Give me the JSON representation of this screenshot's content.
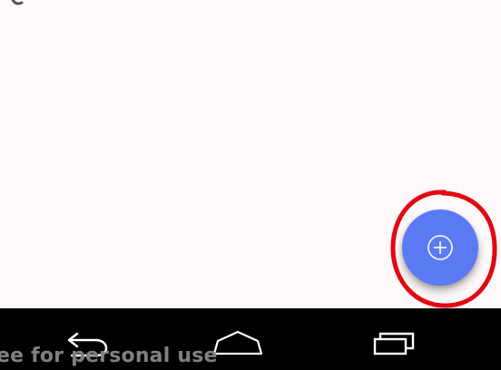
{
  "fab": {
    "icon": "add-circle-icon",
    "color": "#5b7bf5"
  },
  "annotation": {
    "color": "#e30613"
  },
  "nav_bar": {
    "background": "#000000",
    "buttons": [
      {
        "icon": "back-arrow-icon"
      },
      {
        "icon": "home-icon"
      },
      {
        "icon": "recents-icon"
      }
    ]
  },
  "watermark": {
    "text": "ee for personal use"
  }
}
